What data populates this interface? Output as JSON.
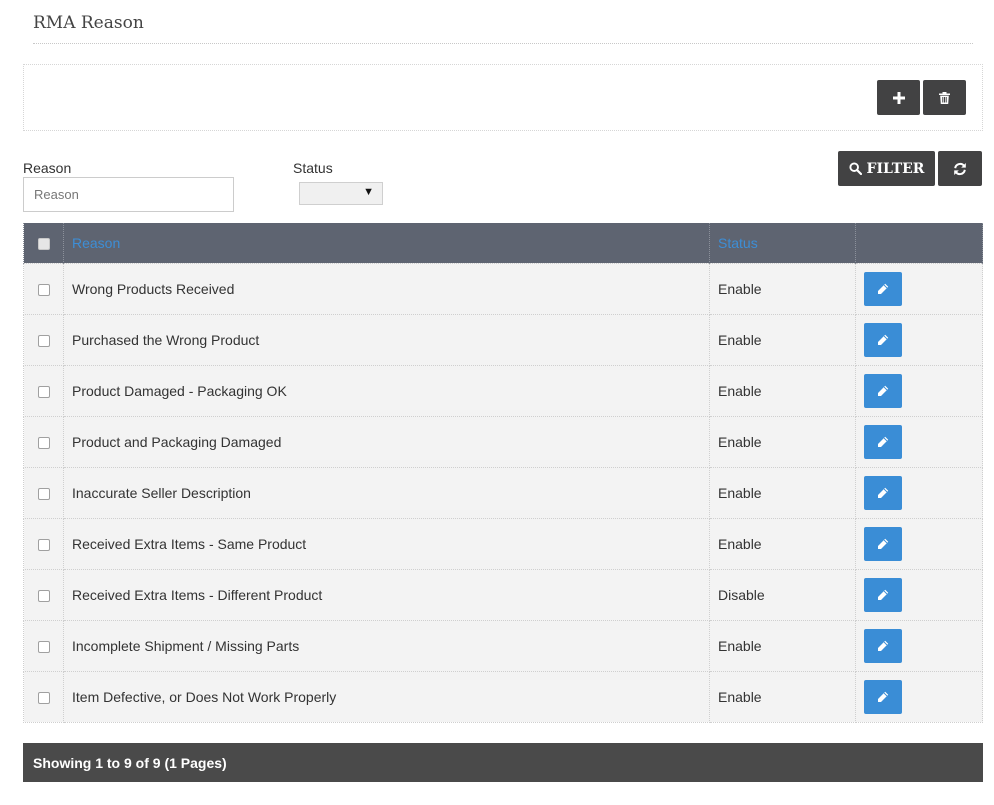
{
  "page": {
    "title": "RMA Reason"
  },
  "toolbar": {
    "add_icon": "plus-icon",
    "delete_icon": "trash-icon"
  },
  "filter": {
    "reason_label": "Reason",
    "reason_placeholder": "Reason",
    "reason_value": "",
    "status_label": "Status",
    "status_selected": "",
    "filter_button_label": "FILTER",
    "filter_icon": "search-icon",
    "reset_icon": "refresh-icon"
  },
  "table": {
    "columns": {
      "reason": "Reason",
      "status": "Status"
    },
    "rows": [
      {
        "reason": "Wrong Products Received",
        "status": "Enable"
      },
      {
        "reason": "Purchased the Wrong Product",
        "status": "Enable"
      },
      {
        "reason": "Product Damaged - Packaging OK",
        "status": "Enable"
      },
      {
        "reason": "Product and Packaging Damaged",
        "status": "Enable"
      },
      {
        "reason": "Inaccurate Seller Description",
        "status": "Enable"
      },
      {
        "reason": "Received Extra Items - Same Product",
        "status": "Enable"
      },
      {
        "reason": "Received Extra Items - Different Product",
        "status": "Disable"
      },
      {
        "reason": "Incomplete Shipment / Missing Parts",
        "status": "Enable"
      },
      {
        "reason": "Item Defective, or Does Not Work Properly",
        "status": "Enable"
      }
    ],
    "edit_icon": "pencil-icon"
  },
  "pagination": {
    "summary": "Showing 1 to 9 of 9 (1 Pages)"
  },
  "colors": {
    "header_bg": "#5e6471",
    "header_link": "#3d8ed6",
    "edit_button": "#3a8dd6",
    "dark_button": "#424243",
    "footer_bg": "#4a4a4a"
  }
}
